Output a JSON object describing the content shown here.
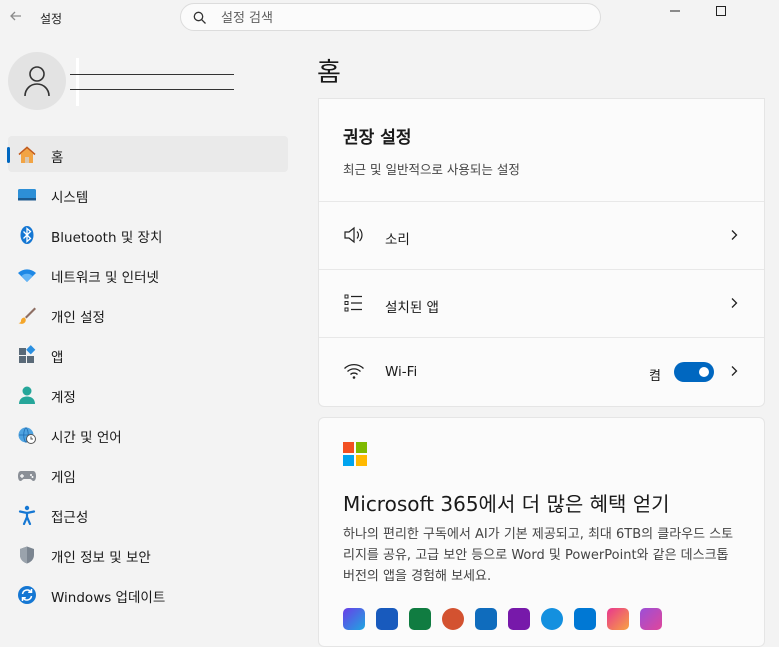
{
  "window": {
    "title": "설정"
  },
  "search": {
    "placeholder": "설정 검색"
  },
  "nav": {
    "items": [
      {
        "label": "홈",
        "icon": "home-icon",
        "active": true
      },
      {
        "label": "시스템",
        "icon": "system-icon"
      },
      {
        "label": "Bluetooth 및 장치",
        "icon": "bluetooth-icon"
      },
      {
        "label": "네트워크 및 인터넷",
        "icon": "network-icon"
      },
      {
        "label": "개인 설정",
        "icon": "brush-icon"
      },
      {
        "label": "앱",
        "icon": "apps-icon"
      },
      {
        "label": "계정",
        "icon": "account-icon"
      },
      {
        "label": "시간 및 언어",
        "icon": "globe-clock-icon"
      },
      {
        "label": "게임",
        "icon": "gamepad-icon"
      },
      {
        "label": "접근성",
        "icon": "accessibility-icon"
      },
      {
        "label": "개인 정보 및 보안",
        "icon": "shield-icon"
      },
      {
        "label": "Windows 업데이트",
        "icon": "update-icon"
      }
    ]
  },
  "main": {
    "page_title": "홈",
    "recommended": {
      "title": "권장 설정",
      "subtitle": "최근 및 일반적으로 사용되는 설정",
      "rows": [
        {
          "label": "소리",
          "icon": "speaker-icon"
        },
        {
          "label": "설치된 앱",
          "icon": "list-icon"
        },
        {
          "label": "Wi-Fi",
          "icon": "wifi-icon",
          "toggle_state": "켬",
          "toggle_on": true
        }
      ]
    },
    "promo": {
      "title": "Microsoft 365에서 더 많은 혜택 얻기",
      "body": "하나의 편리한 구독에서 AI가 기본 제공되고, 최대 6TB의 클라우드 스토리지를 공유, 고급 보안 등으로 Word 및 PowerPoint와 같은 데스크톱 버전의 앱을 경험해 보세요."
    }
  },
  "colors": {
    "accent": "#0067c0"
  }
}
